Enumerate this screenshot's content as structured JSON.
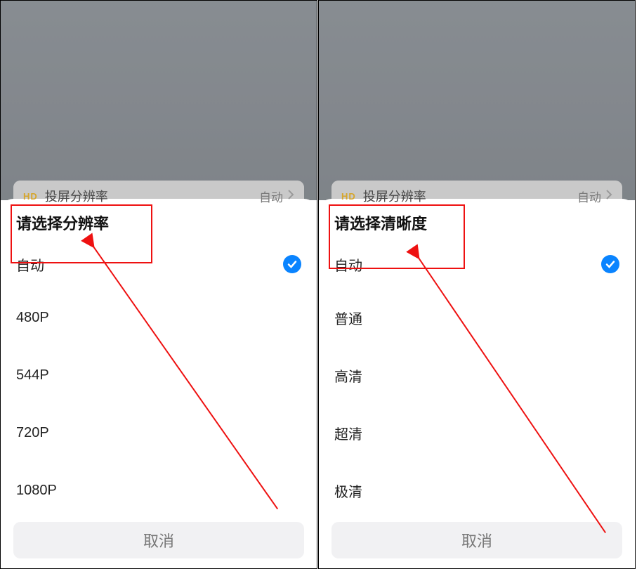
{
  "left": {
    "bgRow": {
      "badge": "HD",
      "label": "投屏分辨率",
      "value": "自动"
    },
    "sheet": {
      "title": "请选择分辨率",
      "options": [
        "自动",
        "480P",
        "544P",
        "720P",
        "1080P"
      ],
      "selectedIndex": 0,
      "cancel": "取消"
    }
  },
  "right": {
    "bgRow": {
      "badge": "HD",
      "label": "投屏分辨率",
      "value": "自动"
    },
    "sheet": {
      "title": "请选择清晰度",
      "options": [
        "自动",
        "普通",
        "高清",
        "超清",
        "极清"
      ],
      "selectedIndex": 0,
      "cancel": "取消"
    }
  },
  "colors": {
    "accent": "#0a84ff",
    "annotation": "#e11"
  }
}
